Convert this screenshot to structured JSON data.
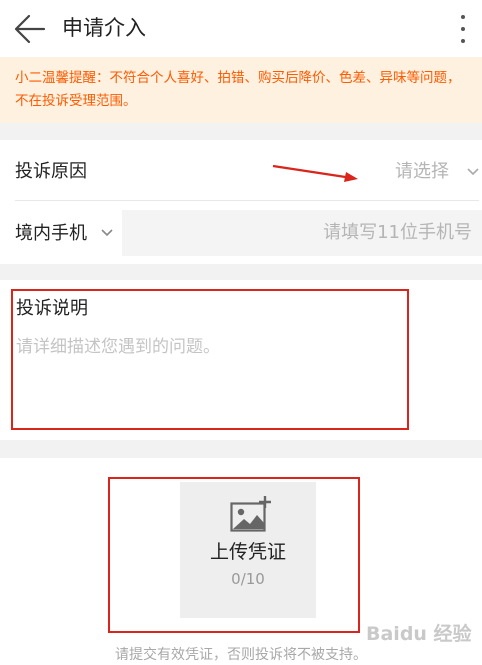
{
  "header": {
    "title": "申请介入",
    "back_icon": "arrow-left-icon",
    "more_icon": "more-vertical-icon"
  },
  "notice": {
    "text": "小二温馨提醒：不符合个人喜好、拍错、购买后降价、色差、异味等问题，不在投诉受理范围。"
  },
  "form": {
    "reason_label": "投诉原因",
    "reason_placeholder": "请选择",
    "phone_type_label": "境内手机",
    "phone_placeholder": "请填写11位手机号"
  },
  "description": {
    "title": "投诉说明",
    "placeholder": "请详细描述您遇到的问题。"
  },
  "upload": {
    "label": "上传凭证",
    "count": "0/10",
    "icon": "add-photo-icon"
  },
  "footer": {
    "tip": "请提交有效凭证，否则投诉将不被支持。"
  },
  "watermark": {
    "text": "Baidu 经验"
  },
  "colors": {
    "accent": "#ff5a00",
    "annotation": "#d9251c",
    "notice_bg": "#fff1e0"
  }
}
